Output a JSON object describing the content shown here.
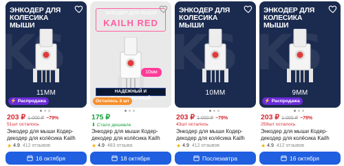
{
  "cards": [
    {
      "photo_title": "Энкодер для колесика мыши",
      "size_label": "11MM",
      "badge": "Распродажа",
      "price": "203 ₽",
      "old_price": "1 000 ₽",
      "discount": "−79%",
      "note": "51шт осталось",
      "title": "Энкодер для мыши Кодер-декодер для колёсика Kailh Red...",
      "rating": "4.9",
      "reviews": "412 отзывов",
      "delivery": "16 октября"
    },
    {
      "plate_sub": "Энкодер для мыши",
      "plate_brand": "Kailh Red",
      "pink_tag": "10мм",
      "banner": "НАДЕЖНЫЙ И ВЫСОКОТОЧНЫЙ",
      "badge": "Осталось 3 шт",
      "price": "175 ₽",
      "note": "Стало дешевле",
      "title": "Энкодер для мыши Кодер-декодер для колёсика Kailh Red...",
      "rating": "4.9",
      "reviews": "483 отзыва",
      "delivery": "18 октября"
    },
    {
      "photo_title": "Энкодер для колесика мыши",
      "size_label": "10MM",
      "price": "203 ₽",
      "old_price": "1 000 ₽",
      "discount": "−79%",
      "note": "43шт осталось",
      "title": "Энкодер для мыши Кодер-декодер для колёсика Kailh Red...",
      "rating": "4.9",
      "reviews": "412 отзывов",
      "delivery": "Послезавтра"
    },
    {
      "photo_title": "Энкодер для колесика мыши",
      "size_label": "9MM",
      "badge": "Распродажа",
      "price": "203 ₽",
      "old_price": "1 000 ₽",
      "discount": "−79%",
      "note": "259шт осталось",
      "title": "Энкодер для мыши Кодер-декодер для колёсика Kailh Red...",
      "rating": "4.9",
      "reviews": "412 отзывов",
      "delivery": "16 октября"
    }
  ],
  "colors": {
    "accent_blue": "#1f5fe0",
    "price_red": "#d8262d",
    "price_green": "#14a03b",
    "sale_purple": "#6a2bd9",
    "kailh_pink": "#ff5ea0"
  },
  "icons": {
    "favorite": "heart-icon",
    "delivery": "calendar-icon",
    "rating": "star-icon",
    "sale": "lightning-icon",
    "cheaper": "arrow-down-icon"
  }
}
